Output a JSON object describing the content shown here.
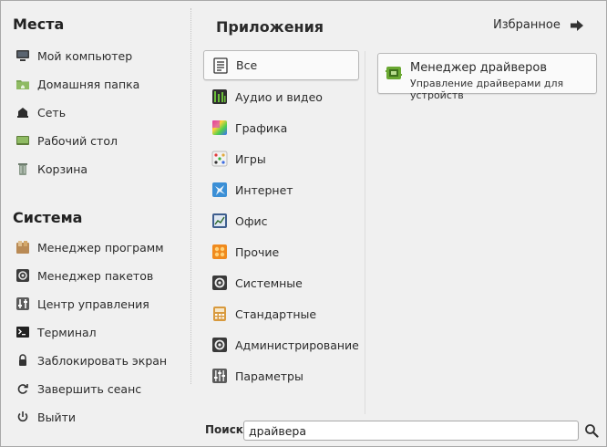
{
  "places": {
    "title": "Места",
    "items": [
      {
        "label": "Мой компьютер",
        "icon": "computer-icon"
      },
      {
        "label": "Домашняя папка",
        "icon": "home-folder-icon"
      },
      {
        "label": "Сеть",
        "icon": "network-icon"
      },
      {
        "label": "Рабочий стол",
        "icon": "desktop-icon"
      },
      {
        "label": "Корзина",
        "icon": "trash-icon"
      }
    ]
  },
  "system": {
    "title": "Система",
    "items": [
      {
        "label": "Менеджер программ",
        "icon": "software-manager-icon"
      },
      {
        "label": "Менеджер пакетов",
        "icon": "package-manager-icon"
      },
      {
        "label": "Центр управления",
        "icon": "control-center-icon"
      },
      {
        "label": "Терминал",
        "icon": "terminal-icon"
      },
      {
        "label": "Заблокировать экран",
        "icon": "lock-icon"
      },
      {
        "label": "Завершить сеанс",
        "icon": "logout-icon"
      },
      {
        "label": "Выйти",
        "icon": "power-icon"
      }
    ]
  },
  "apps": {
    "title": "Приложения",
    "favorites_label": "Избранное",
    "categories": [
      {
        "label": "Все",
        "icon": "all-apps-icon",
        "active": true
      },
      {
        "label": "Аудио и видео",
        "icon": "multimedia-icon"
      },
      {
        "label": "Графика",
        "icon": "graphics-icon"
      },
      {
        "label": "Игры",
        "icon": "games-icon"
      },
      {
        "label": "Интернет",
        "icon": "internet-icon"
      },
      {
        "label": "Офис",
        "icon": "office-icon"
      },
      {
        "label": "Прочие",
        "icon": "other-icon"
      },
      {
        "label": "Системные",
        "icon": "system-icon"
      },
      {
        "label": "Стандартные",
        "icon": "accessories-icon"
      },
      {
        "label": "Администрирование",
        "icon": "administration-icon"
      },
      {
        "label": "Параметры",
        "icon": "preferences-icon"
      }
    ]
  },
  "results": [
    {
      "name": "Менеджер драйверов",
      "description": "Управление драйверами для устройств",
      "icon": "driver-manager-icon"
    }
  ],
  "search": {
    "label": "Поиск:",
    "value": "драйвера"
  },
  "colors": {
    "background": "#f0f0f0",
    "accent_green": "#6aa832",
    "border": "#b9b9b9"
  }
}
